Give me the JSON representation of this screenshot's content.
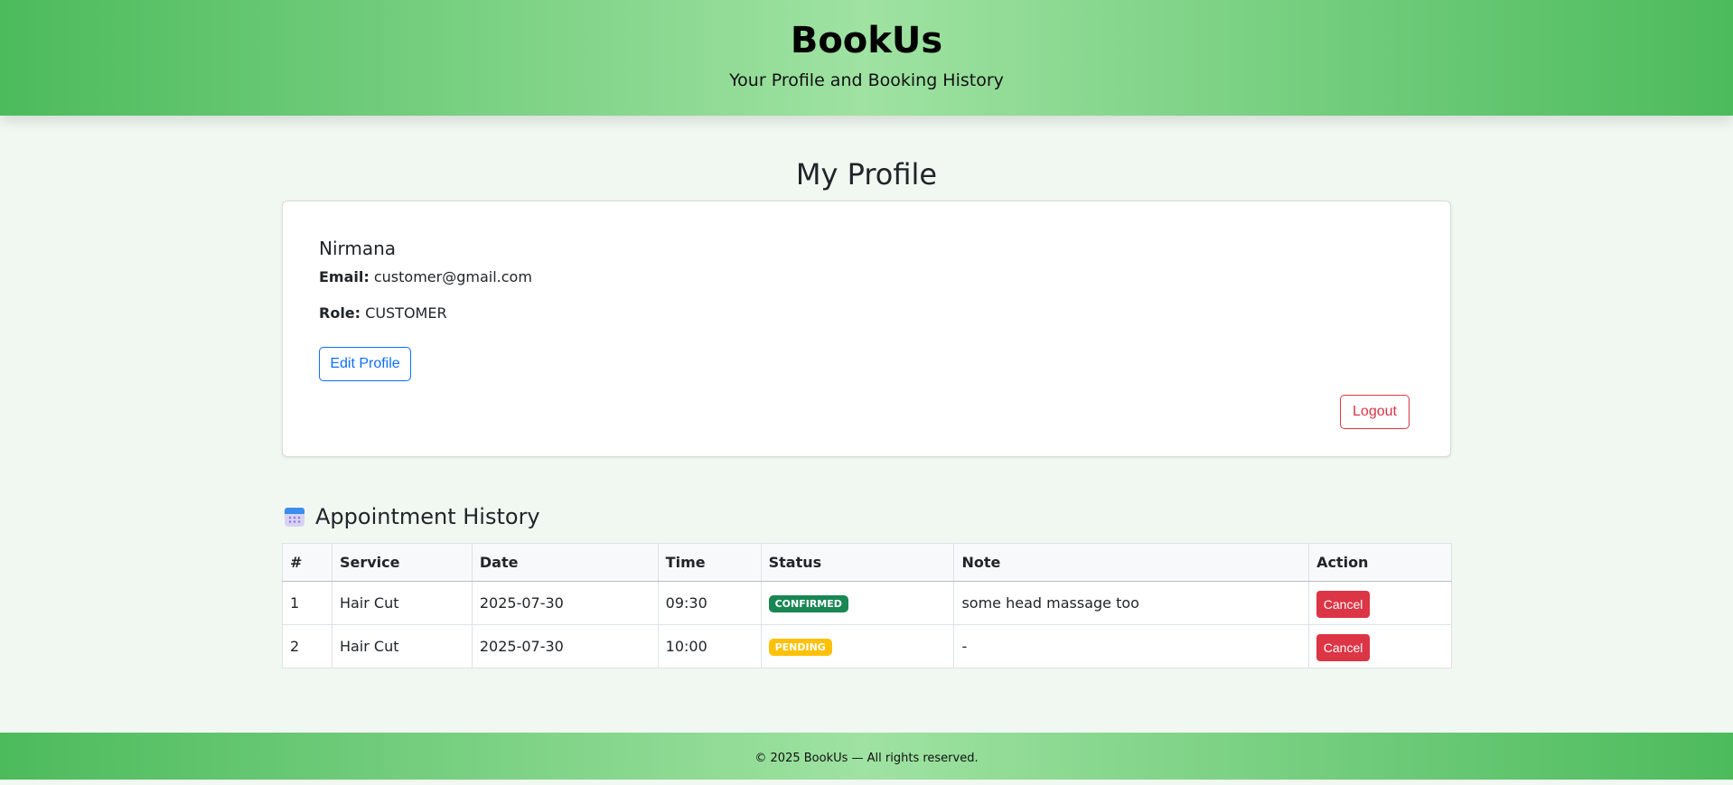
{
  "header": {
    "brand": "BookUs",
    "tagline": "Your Profile and Booking History"
  },
  "profile": {
    "page_title": "My Profile",
    "name": "Nirmana",
    "email_label": "Email:",
    "email": "customer@gmail.com",
    "role_label": "Role:",
    "role": "CUSTOMER",
    "edit_label": "Edit Profile",
    "logout_label": "Logout"
  },
  "history": {
    "icon": "calendar-icon",
    "title": "Appointment History",
    "columns": [
      "#",
      "Service",
      "Date",
      "Time",
      "Status",
      "Note",
      "Action"
    ],
    "rows": [
      {
        "num": "1",
        "service": "Hair Cut",
        "date": "2025-07-30",
        "time": "09:30",
        "status": "CONFIRMED",
        "note": "some head massage too",
        "action": "Cancel"
      },
      {
        "num": "2",
        "service": "Hair Cut",
        "date": "2025-07-30",
        "time": "10:00",
        "status": "PENDING",
        "note": "-",
        "action": "Cancel"
      }
    ]
  },
  "footer": {
    "text": "© 2025 BookUs — All rights reserved."
  },
  "colors": {
    "header_green": "#4cbb5c",
    "header_light": "#9fe2a2",
    "primary": "#0d6efd",
    "danger": "#dc3545",
    "confirmed": "#198754",
    "pending": "#ffc107"
  }
}
